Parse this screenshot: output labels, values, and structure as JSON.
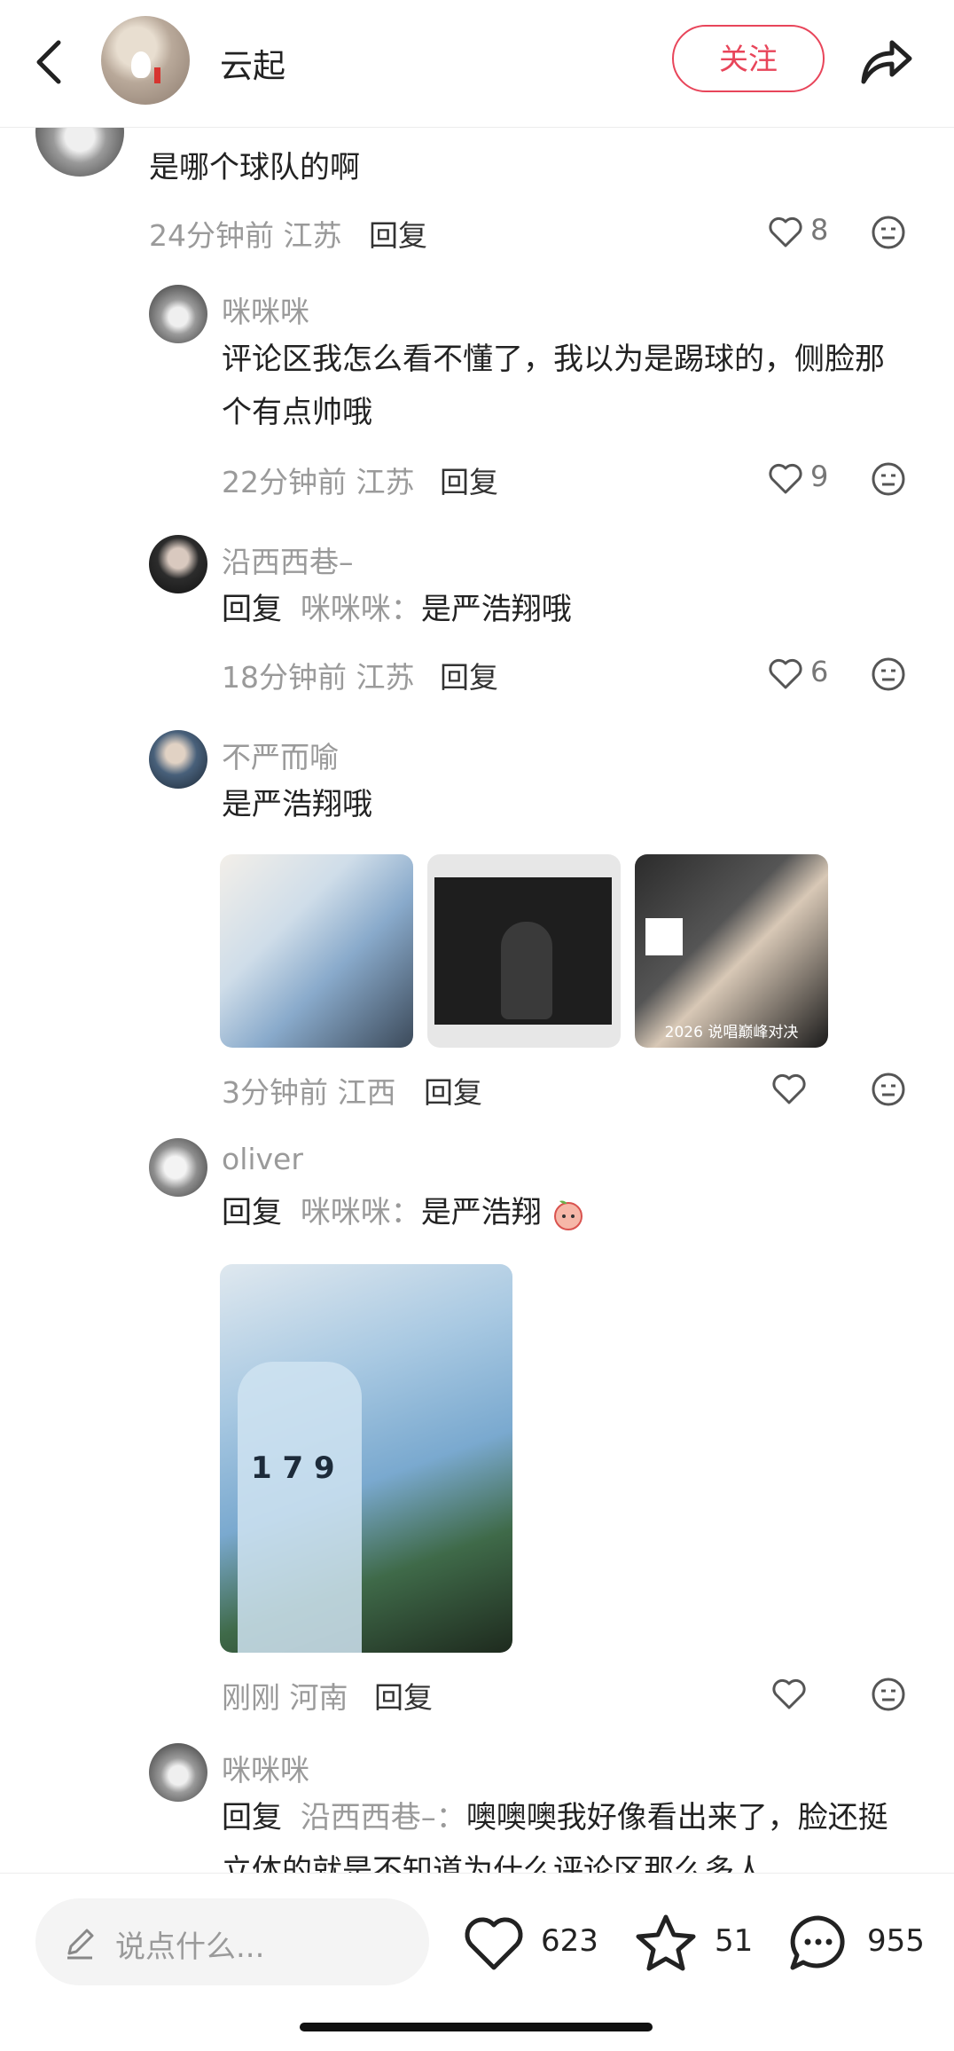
{
  "header": {
    "author_name": "云起",
    "follow_label": "关注"
  },
  "comments": [
    {
      "text": "是哪个球队的啊",
      "time_location": "24分钟前 江苏",
      "reply_label": "回复",
      "likes": "8"
    },
    {
      "username": "咪咪咪",
      "text": "评论区我怎么看不懂了，我以为是踢球的，侧脸那个有点帅哦",
      "time_location": "22分钟前 江苏",
      "reply_label": "回复",
      "likes": "9"
    },
    {
      "username": "沿西西巷–",
      "reply_prefix": "回复",
      "reply_to": "咪咪咪：",
      "text": "是严浩翔哦",
      "time_location": "18分钟前 江苏",
      "reply_label": "回复",
      "likes": "6"
    },
    {
      "username": "不严而喻",
      "text": "是严浩翔哦",
      "time_location": "3分钟前 江西",
      "reply_label": "回复",
      "image_caption": "2026 说唱巅峰对决"
    },
    {
      "username": "oliver",
      "reply_prefix": "回复",
      "reply_to": "咪咪咪：",
      "text": "是严浩翔",
      "image_number": "1 7 9",
      "time_location": "刚刚 河南",
      "reply_label": "回复"
    },
    {
      "username": "咪咪咪",
      "reply_prefix": "回复",
      "reply_to": "沿西西巷–：",
      "text": "噢噢噢我好像看出来了，脸还挺立体的就是不知道为什么评论区那么多人"
    }
  ],
  "bottom_bar": {
    "input_placeholder": "说点什么...",
    "like_count": "623",
    "collect_count": "51",
    "comment_count": "955"
  },
  "colors": {
    "accent": "#e8455a",
    "muted_text": "#9a9a9a"
  },
  "icons": [
    "back-icon",
    "share-icon",
    "heart-icon",
    "emoji-face-icon",
    "pencil-icon",
    "star-icon",
    "comment-bubble-icon"
  ]
}
